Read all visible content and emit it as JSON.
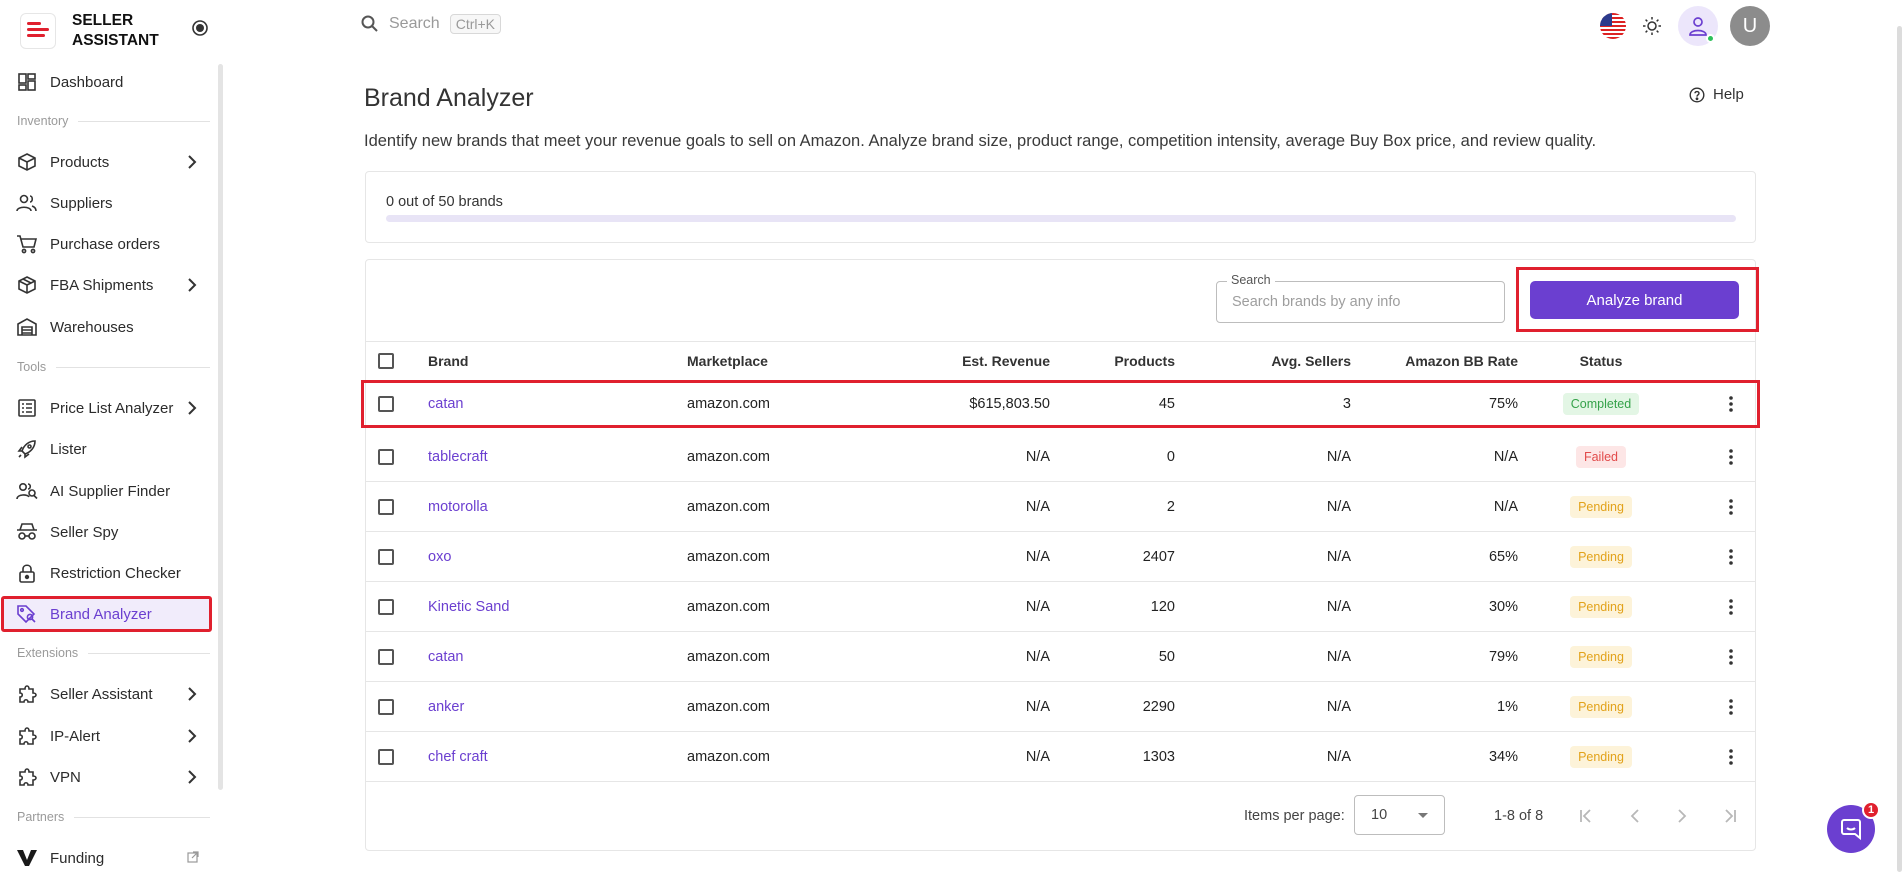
{
  "app": {
    "name": "SELLER\nASSISTANT"
  },
  "topbar": {
    "search_placeholder": "Search",
    "shortcut": "Ctrl+K",
    "avatar_letter": "U"
  },
  "sidebar": {
    "dashboard": "Dashboard",
    "sections": {
      "inventory": "Inventory",
      "tools": "Tools",
      "extensions": "Extensions",
      "partners": "Partners"
    },
    "items": {
      "products": "Products",
      "suppliers": "Suppliers",
      "purchase_orders": "Purchase orders",
      "fba_shipments": "FBA Shipments",
      "warehouses": "Warehouses",
      "price_list_analyzer": "Price List Analyzer",
      "lister": "Lister",
      "ai_supplier_finder": "AI Supplier Finder",
      "seller_spy": "Seller Spy",
      "restriction_checker": "Restriction Checker",
      "brand_analyzer": "Brand Analyzer",
      "seller_assistant": "Seller Assistant",
      "ip_alert": "IP-Alert",
      "vpn": "VPN",
      "funding": "Funding"
    }
  },
  "main": {
    "title": "Brand Analyzer",
    "help": "Help",
    "description": "Identify new brands that meet your revenue goals to sell on Amazon. Analyze brand size, product range, competition intensity, average Buy Box price, and review quality.",
    "usage": {
      "label": "0 out of 50 brands",
      "fraction": 0
    },
    "search": {
      "legend": "Search",
      "placeholder": "Search brands by any info"
    },
    "analyze_button": "Analyze brand",
    "columns": {
      "brand": "Brand",
      "marketplace": "Marketplace",
      "revenue": "Est. Revenue",
      "products": "Products",
      "sellers": "Avg. Sellers",
      "bb_rate": "Amazon BB Rate",
      "status": "Status"
    },
    "rows": [
      {
        "brand": "catan",
        "marketplace": "amazon.com",
        "revenue": "$615,803.50",
        "products": "45",
        "sellers": "3",
        "bb_rate": "75%",
        "status": "Completed"
      },
      {
        "brand": "tablecraft",
        "marketplace": "amazon.com",
        "revenue": "N/A",
        "products": "0",
        "sellers": "N/A",
        "bb_rate": "N/A",
        "status": "Failed"
      },
      {
        "brand": "motorolla",
        "marketplace": "amazon.com",
        "revenue": "N/A",
        "products": "2",
        "sellers": "N/A",
        "bb_rate": "N/A",
        "status": "Pending"
      },
      {
        "brand": "oxo",
        "marketplace": "amazon.com",
        "revenue": "N/A",
        "products": "2407",
        "sellers": "N/A",
        "bb_rate": "65%",
        "status": "Pending"
      },
      {
        "brand": "Kinetic Sand",
        "marketplace": "amazon.com",
        "revenue": "N/A",
        "products": "120",
        "sellers": "N/A",
        "bb_rate": "30%",
        "status": "Pending"
      },
      {
        "brand": "catan",
        "marketplace": "amazon.com",
        "revenue": "N/A",
        "products": "50",
        "sellers": "N/A",
        "bb_rate": "79%",
        "status": "Pending"
      },
      {
        "brand": "anker",
        "marketplace": "amazon.com",
        "revenue": "N/A",
        "products": "2290",
        "sellers": "N/A",
        "bb_rate": "1%",
        "status": "Pending"
      },
      {
        "brand": "chef craft",
        "marketplace": "amazon.com",
        "revenue": "N/A",
        "products": "1303",
        "sellers": "N/A",
        "bb_rate": "34%",
        "status": "Pending"
      }
    ],
    "pagination": {
      "items_per_page_label": "Items per page:",
      "items_per_page": "10",
      "range": "1-8 of 8"
    }
  },
  "chat": {
    "badge": "1"
  },
  "colors": {
    "accent": "#6b3fd0",
    "highlight": "#e0202e",
    "completed": "#35a24a",
    "failed": "#e24b4b",
    "pending": "#e2a21a"
  }
}
